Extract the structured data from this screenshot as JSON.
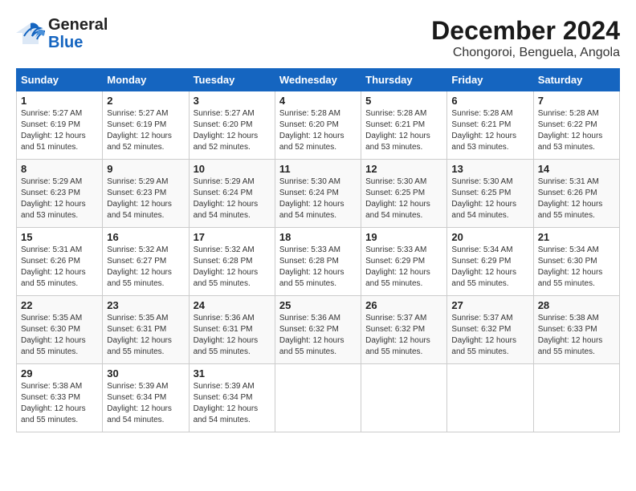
{
  "header": {
    "logo_line1": "General",
    "logo_line2": "Blue",
    "month": "December 2024",
    "location": "Chongoroi, Benguela, Angola"
  },
  "columns": [
    "Sunday",
    "Monday",
    "Tuesday",
    "Wednesday",
    "Thursday",
    "Friday",
    "Saturday"
  ],
  "weeks": [
    [
      {
        "day": "1",
        "sunrise": "Sunrise: 5:27 AM",
        "sunset": "Sunset: 6:19 PM",
        "daylight": "Daylight: 12 hours and 51 minutes."
      },
      {
        "day": "2",
        "sunrise": "Sunrise: 5:27 AM",
        "sunset": "Sunset: 6:19 PM",
        "daylight": "Daylight: 12 hours and 52 minutes."
      },
      {
        "day": "3",
        "sunrise": "Sunrise: 5:27 AM",
        "sunset": "Sunset: 6:20 PM",
        "daylight": "Daylight: 12 hours and 52 minutes."
      },
      {
        "day": "4",
        "sunrise": "Sunrise: 5:28 AM",
        "sunset": "Sunset: 6:20 PM",
        "daylight": "Daylight: 12 hours and 52 minutes."
      },
      {
        "day": "5",
        "sunrise": "Sunrise: 5:28 AM",
        "sunset": "Sunset: 6:21 PM",
        "daylight": "Daylight: 12 hours and 53 minutes."
      },
      {
        "day": "6",
        "sunrise": "Sunrise: 5:28 AM",
        "sunset": "Sunset: 6:21 PM",
        "daylight": "Daylight: 12 hours and 53 minutes."
      },
      {
        "day": "7",
        "sunrise": "Sunrise: 5:28 AM",
        "sunset": "Sunset: 6:22 PM",
        "daylight": "Daylight: 12 hours and 53 minutes."
      }
    ],
    [
      {
        "day": "8",
        "sunrise": "Sunrise: 5:29 AM",
        "sunset": "Sunset: 6:23 PM",
        "daylight": "Daylight: 12 hours and 53 minutes."
      },
      {
        "day": "9",
        "sunrise": "Sunrise: 5:29 AM",
        "sunset": "Sunset: 6:23 PM",
        "daylight": "Daylight: 12 hours and 54 minutes."
      },
      {
        "day": "10",
        "sunrise": "Sunrise: 5:29 AM",
        "sunset": "Sunset: 6:24 PM",
        "daylight": "Daylight: 12 hours and 54 minutes."
      },
      {
        "day": "11",
        "sunrise": "Sunrise: 5:30 AM",
        "sunset": "Sunset: 6:24 PM",
        "daylight": "Daylight: 12 hours and 54 minutes."
      },
      {
        "day": "12",
        "sunrise": "Sunrise: 5:30 AM",
        "sunset": "Sunset: 6:25 PM",
        "daylight": "Daylight: 12 hours and 54 minutes."
      },
      {
        "day": "13",
        "sunrise": "Sunrise: 5:30 AM",
        "sunset": "Sunset: 6:25 PM",
        "daylight": "Daylight: 12 hours and 54 minutes."
      },
      {
        "day": "14",
        "sunrise": "Sunrise: 5:31 AM",
        "sunset": "Sunset: 6:26 PM",
        "daylight": "Daylight: 12 hours and 55 minutes."
      }
    ],
    [
      {
        "day": "15",
        "sunrise": "Sunrise: 5:31 AM",
        "sunset": "Sunset: 6:26 PM",
        "daylight": "Daylight: 12 hours and 55 minutes."
      },
      {
        "day": "16",
        "sunrise": "Sunrise: 5:32 AM",
        "sunset": "Sunset: 6:27 PM",
        "daylight": "Daylight: 12 hours and 55 minutes."
      },
      {
        "day": "17",
        "sunrise": "Sunrise: 5:32 AM",
        "sunset": "Sunset: 6:28 PM",
        "daylight": "Daylight: 12 hours and 55 minutes."
      },
      {
        "day": "18",
        "sunrise": "Sunrise: 5:33 AM",
        "sunset": "Sunset: 6:28 PM",
        "daylight": "Daylight: 12 hours and 55 minutes."
      },
      {
        "day": "19",
        "sunrise": "Sunrise: 5:33 AM",
        "sunset": "Sunset: 6:29 PM",
        "daylight": "Daylight: 12 hours and 55 minutes."
      },
      {
        "day": "20",
        "sunrise": "Sunrise: 5:34 AM",
        "sunset": "Sunset: 6:29 PM",
        "daylight": "Daylight: 12 hours and 55 minutes."
      },
      {
        "day": "21",
        "sunrise": "Sunrise: 5:34 AM",
        "sunset": "Sunset: 6:30 PM",
        "daylight": "Daylight: 12 hours and 55 minutes."
      }
    ],
    [
      {
        "day": "22",
        "sunrise": "Sunrise: 5:35 AM",
        "sunset": "Sunset: 6:30 PM",
        "daylight": "Daylight: 12 hours and 55 minutes."
      },
      {
        "day": "23",
        "sunrise": "Sunrise: 5:35 AM",
        "sunset": "Sunset: 6:31 PM",
        "daylight": "Daylight: 12 hours and 55 minutes."
      },
      {
        "day": "24",
        "sunrise": "Sunrise: 5:36 AM",
        "sunset": "Sunset: 6:31 PM",
        "daylight": "Daylight: 12 hours and 55 minutes."
      },
      {
        "day": "25",
        "sunrise": "Sunrise: 5:36 AM",
        "sunset": "Sunset: 6:32 PM",
        "daylight": "Daylight: 12 hours and 55 minutes."
      },
      {
        "day": "26",
        "sunrise": "Sunrise: 5:37 AM",
        "sunset": "Sunset: 6:32 PM",
        "daylight": "Daylight: 12 hours and 55 minutes."
      },
      {
        "day": "27",
        "sunrise": "Sunrise: 5:37 AM",
        "sunset": "Sunset: 6:32 PM",
        "daylight": "Daylight: 12 hours and 55 minutes."
      },
      {
        "day": "28",
        "sunrise": "Sunrise: 5:38 AM",
        "sunset": "Sunset: 6:33 PM",
        "daylight": "Daylight: 12 hours and 55 minutes."
      }
    ],
    [
      {
        "day": "29",
        "sunrise": "Sunrise: 5:38 AM",
        "sunset": "Sunset: 6:33 PM",
        "daylight": "Daylight: 12 hours and 55 minutes."
      },
      {
        "day": "30",
        "sunrise": "Sunrise: 5:39 AM",
        "sunset": "Sunset: 6:34 PM",
        "daylight": "Daylight: 12 hours and 54 minutes."
      },
      {
        "day": "31",
        "sunrise": "Sunrise: 5:39 AM",
        "sunset": "Sunset: 6:34 PM",
        "daylight": "Daylight: 12 hours and 54 minutes."
      },
      null,
      null,
      null,
      null
    ]
  ]
}
